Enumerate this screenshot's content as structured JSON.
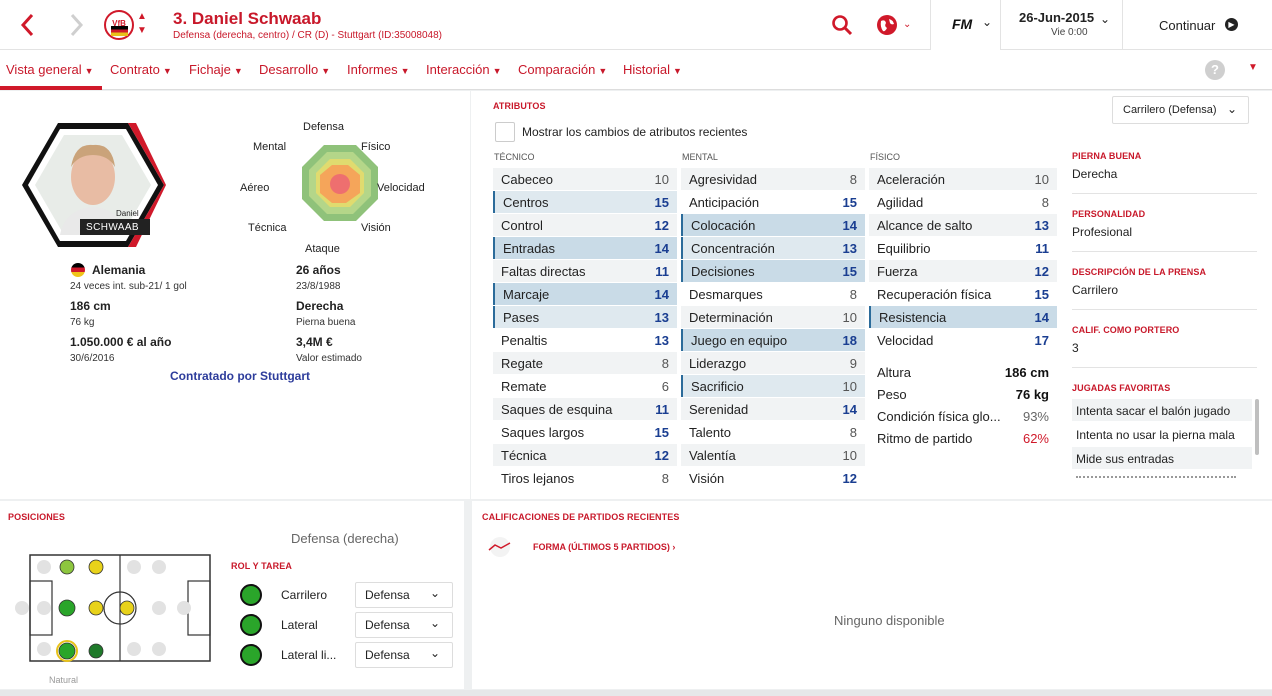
{
  "header": {
    "player_title": "3. Daniel Schwaab",
    "player_subtitle": "Defensa (derecha, centro) / CR (D) - Stuttgart (ID:35008048)",
    "club_badge_text": "VfB",
    "date": "26-Jun-2015",
    "day_time": "Vie 0:00",
    "continue_label": "Continuar",
    "fm_label": "FM"
  },
  "menu": [
    {
      "label": "Vista general"
    },
    {
      "label": "Contrato"
    },
    {
      "label": "Fichaje"
    },
    {
      "label": "Desarrollo"
    },
    {
      "label": "Informes"
    },
    {
      "label": "Interacción"
    },
    {
      "label": "Comparación"
    },
    {
      "label": "Historial"
    }
  ],
  "profile": {
    "photo_name_first": "Daniel",
    "photo_name_last": "SCHWAAB",
    "nationality": "Alemania",
    "caps": "24 veces int. sub-21/ 1 gol",
    "age": "26 años",
    "dob": "23/8/1988",
    "height": "186 cm",
    "weight": "76 kg",
    "foot": "Derecha",
    "foot_label": "Pierna buena",
    "wage": "1.050.000 € al año",
    "contract_end": "30/6/2016",
    "value": "3,4M €",
    "value_label": "Valor estimado",
    "signed_by": "Contratado por Stuttgart"
  },
  "radar": {
    "labels": {
      "defensa": "Defensa",
      "fisico": "Físico",
      "velocidad": "Velocidad",
      "vision": "Visión",
      "ataque": "Ataque",
      "tecnica": "Técnica",
      "aereo": "Aéreo",
      "mental": "Mental"
    }
  },
  "attributes": {
    "title": "ATRIBUTOS",
    "checkbox_label": "Mostrar los cambios de atributos recientes",
    "role_dropdown": "Carrilero (Defensa)",
    "tecnico_header": "TÉCNICO",
    "mental_header": "MENTAL",
    "fisico_header": "FÍSICO",
    "tecnico": [
      {
        "name": "Cabeceo",
        "value": "10"
      },
      {
        "name": "Centros",
        "value": "15"
      },
      {
        "name": "Control",
        "value": "12"
      },
      {
        "name": "Entradas",
        "value": "14"
      },
      {
        "name": "Faltas directas",
        "value": "11"
      },
      {
        "name": "Marcaje",
        "value": "14"
      },
      {
        "name": "Pases",
        "value": "13"
      },
      {
        "name": "Penaltis",
        "value": "13"
      },
      {
        "name": "Regate",
        "value": "8"
      },
      {
        "name": "Remate",
        "value": "6"
      },
      {
        "name": "Saques de esquina",
        "value": "11"
      },
      {
        "name": "Saques largos",
        "value": "15"
      },
      {
        "name": "Técnica",
        "value": "12"
      },
      {
        "name": "Tiros lejanos",
        "value": "8"
      }
    ],
    "mental": [
      {
        "name": "Agresividad",
        "value": "8"
      },
      {
        "name": "Anticipación",
        "value": "15"
      },
      {
        "name": "Colocación",
        "value": "14"
      },
      {
        "name": "Concentración",
        "value": "13"
      },
      {
        "name": "Decisiones",
        "value": "15"
      },
      {
        "name": "Desmarques",
        "value": "8"
      },
      {
        "name": "Determinación",
        "value": "10"
      },
      {
        "name": "Juego en equipo",
        "value": "18"
      },
      {
        "name": "Liderazgo",
        "value": "9"
      },
      {
        "name": "Sacrificio",
        "value": "10"
      },
      {
        "name": "Serenidad",
        "value": "14"
      },
      {
        "name": "Talento",
        "value": "8"
      },
      {
        "name": "Valentía",
        "value": "10"
      },
      {
        "name": "Visión",
        "value": "12"
      }
    ],
    "fisico": [
      {
        "name": "Aceleración",
        "value": "10"
      },
      {
        "name": "Agilidad",
        "value": "8"
      },
      {
        "name": "Alcance de salto",
        "value": "13"
      },
      {
        "name": "Equilibrio",
        "value": "11"
      },
      {
        "name": "Fuerza",
        "value": "12"
      },
      {
        "name": "Recuperación física",
        "value": "15"
      },
      {
        "name": "Resistencia",
        "value": "14"
      },
      {
        "name": "Velocidad",
        "value": "17"
      }
    ],
    "physical_stats": [
      {
        "name": "Altura",
        "value": "186 cm"
      },
      {
        "name": "Peso",
        "value": "76 kg"
      },
      {
        "name": "Condición física glo...",
        "value": "93%"
      },
      {
        "name": "Ritmo de partido",
        "value": "62%"
      }
    ]
  },
  "side_info": {
    "foot_title": "PIERNA BUENA",
    "foot_value": "Derecha",
    "personality_title": "PERSONALIDAD",
    "personality_value": "Profesional",
    "press_title": "DESCRIPCIÓN DE LA PRENSA",
    "press_value": "Carrilero",
    "gk_title": "CALIF. COMO PORTERO",
    "gk_value": "3",
    "ppm_title": "JUGADAS FAVORITAS",
    "ppms": [
      "Intenta sacar el balón jugado",
      "Intenta no usar la pierna mala",
      "Mide sus entradas"
    ]
  },
  "positions": {
    "title": "POSICIONES",
    "selected_position": "Defensa (derecha)",
    "natural_label": "Natural",
    "roles_title": "ROL Y TAREA",
    "roles": [
      {
        "role": "Carrilero",
        "duty": "Defensa"
      },
      {
        "role": "Lateral",
        "duty": "Defensa"
      },
      {
        "role": "Lateral li...",
        "duty": "Defensa"
      }
    ]
  },
  "recent": {
    "title": "CALIFICACIONES DE PARTIDOS RECIENTES",
    "form_label": "FORMA (ÚLTIMOS 5 PARTIDOS) ›",
    "empty_label": "Ninguno disponible"
  },
  "colors": {
    "accent": "#d0192a",
    "highlight": "#c9dbe7",
    "value_blue": "#1a3e91",
    "pitch_green": "#2aa52a",
    "pitch_yellow": "#e8d21a"
  }
}
